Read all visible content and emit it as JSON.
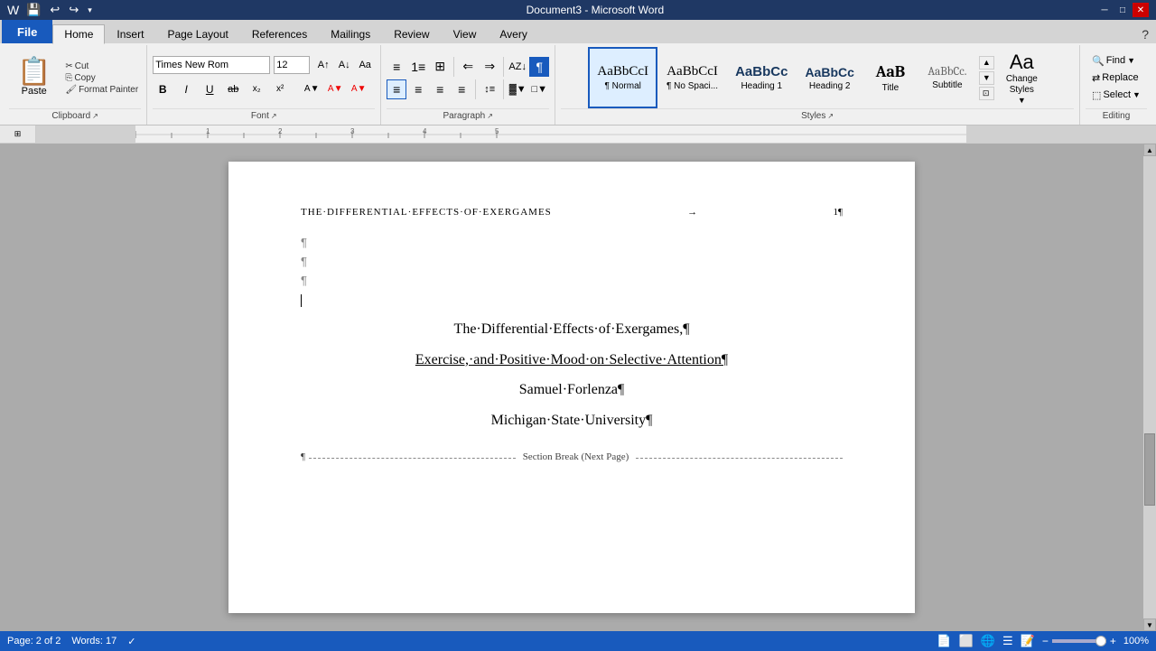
{
  "titlebar": {
    "title": "Document3 - Microsoft Word",
    "min": "─",
    "max": "□",
    "close": "✕"
  },
  "quickaccess": {
    "icons": [
      "💾",
      "↩",
      "↪"
    ]
  },
  "tabs": {
    "file": "File",
    "home": "Home",
    "insert": "Insert",
    "pagelayout": "Page Layout",
    "references": "References",
    "mailings": "Mailings",
    "review": "Review",
    "view": "View",
    "avery": "Avery"
  },
  "ribbon": {
    "clipboard": {
      "label": "Clipboard",
      "paste": "Paste",
      "cut": "Cut",
      "copy": "Copy",
      "format_painter": "Format Painter"
    },
    "font": {
      "label": "Font",
      "name": "Times New Rom",
      "size": "12",
      "bold": "B",
      "italic": "I",
      "underline": "U",
      "strikethrough": "ab",
      "subscript": "x₂",
      "superscript": "x²"
    },
    "paragraph": {
      "label": "Paragraph"
    },
    "styles": {
      "label": "Styles",
      "items": [
        {
          "id": "normal",
          "label": "¶ Normal",
          "preview": "AaBbCcI",
          "active": true
        },
        {
          "id": "no-spacing",
          "label": "¶ No Spaci...",
          "preview": "AaBbCcI"
        },
        {
          "id": "heading1",
          "label": "Heading 1",
          "preview": "AaBbCc"
        },
        {
          "id": "heading2",
          "label": "Heading 2",
          "preview": "AaBbCc"
        },
        {
          "id": "title",
          "label": "Title",
          "preview": "AaB"
        },
        {
          "id": "subtitle",
          "label": "Subtitle",
          "preview": "AaBbCc."
        }
      ],
      "change": "Styles",
      "change_sub": "change"
    },
    "editing": {
      "label": "Editing",
      "find": "Find",
      "replace": "Replace",
      "select": "Select"
    }
  },
  "document": {
    "header_title": "THE·DIFFERENTIAL·EFFECTS·OF·EXERGAMES",
    "header_arrow": "→",
    "header_page": "1¶",
    "para_marks": [
      "¶",
      "¶",
      "¶"
    ],
    "title_line": "The·Differential·Effects·of·Exergames,¶",
    "subtitle_line": "Exercise,·and·Positive·Mood·on·Selective·Attention¶",
    "author_line": "Samuel·Forlenza¶",
    "affiliation_line": "Michigan·State·University¶",
    "section_break": "Section Break (Next Page)"
  },
  "statusbar": {
    "page": "Page: 2 of 2",
    "words": "Words: 17",
    "zoom": "100%"
  }
}
